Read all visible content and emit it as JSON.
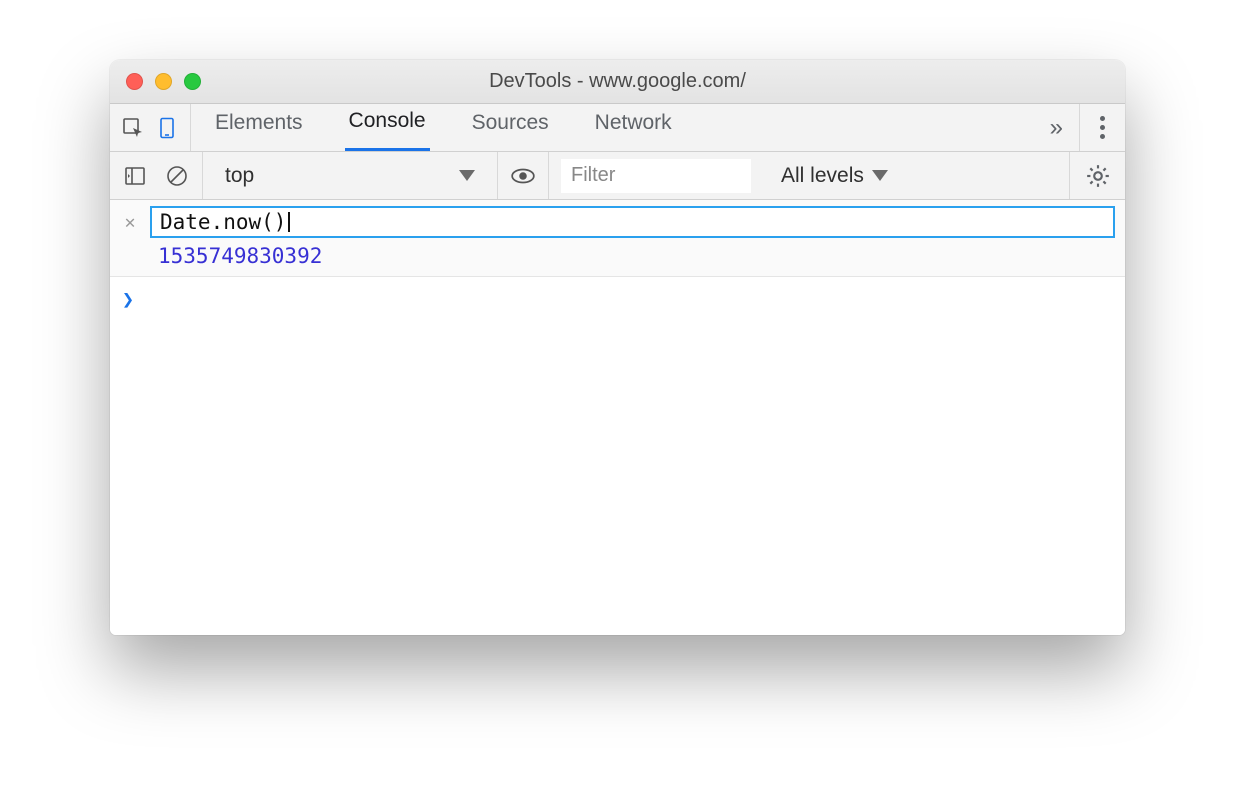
{
  "window": {
    "title": "DevTools - www.google.com/"
  },
  "tabs": {
    "items": [
      "Elements",
      "Console",
      "Sources",
      "Network"
    ],
    "active": "Console",
    "overflow_glyph": "»"
  },
  "filterbar": {
    "context": "top",
    "filter_placeholder": "Filter",
    "filter_value": "",
    "levels_label": "All levels"
  },
  "console": {
    "eager_input": "Date.now()",
    "eager_result": "1535749830392",
    "prompt_glyph": "❯"
  }
}
